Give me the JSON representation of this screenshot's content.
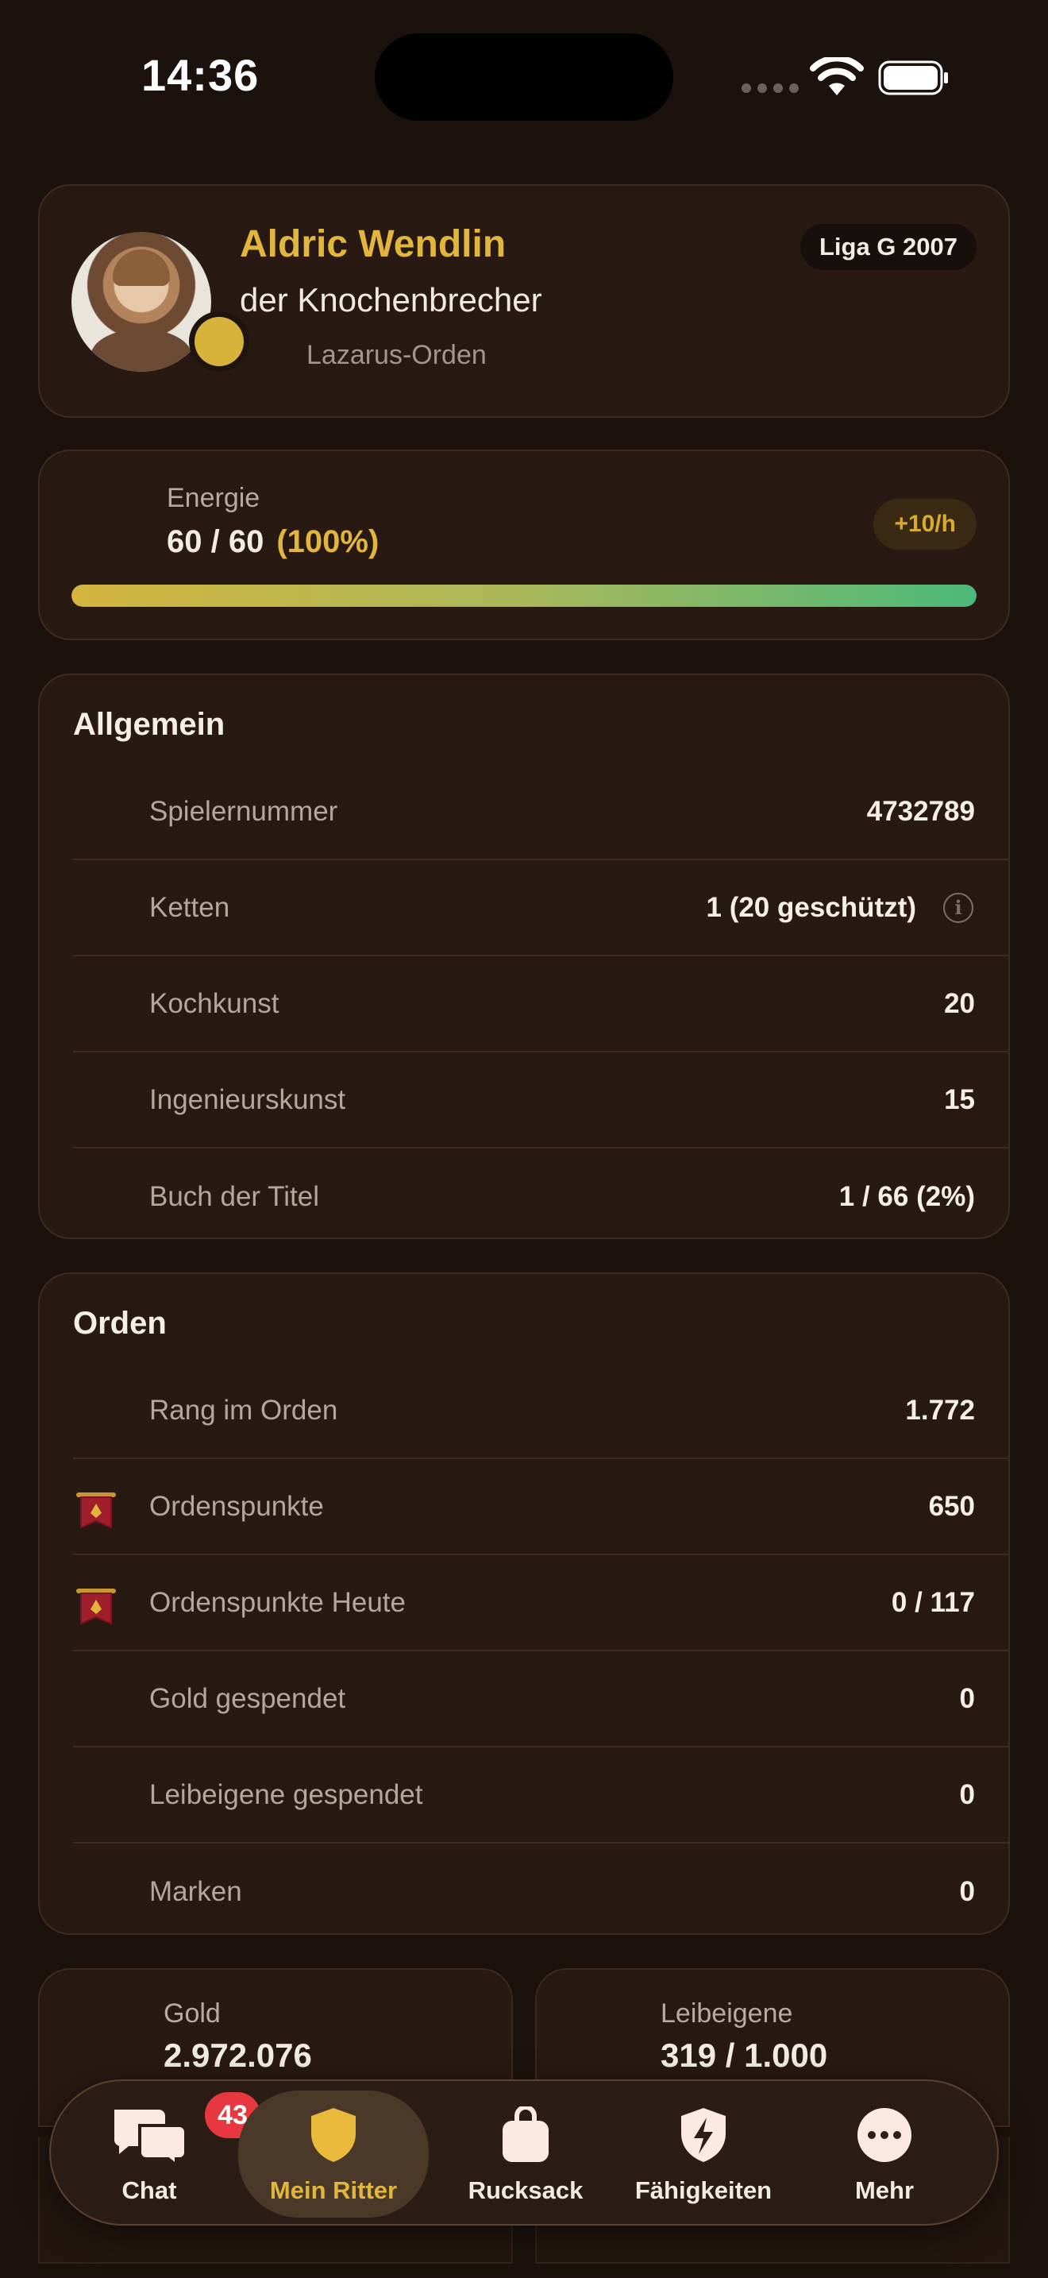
{
  "status_bar": {
    "time": "14:36"
  },
  "profile": {
    "name": "Aldric Wendlin",
    "title": "der Knochenbrecher",
    "order": "Lazarus-Orden",
    "league": "Liga G 2007"
  },
  "energy": {
    "label": "Energie",
    "value": "60 / 60",
    "percent_text": "(100%)",
    "rate": "+10/h",
    "level_fraction": 1.0
  },
  "allgemein": {
    "title": "Allgemein",
    "rows": [
      {
        "label": "Spielernummer",
        "value": "4732789"
      },
      {
        "label": "Ketten",
        "value": "1 (20 geschützt)"
      },
      {
        "label": "Kochkunst",
        "value": "20"
      },
      {
        "label": "Ingenieurskunst",
        "value": "15"
      },
      {
        "label": "Buch der Titel",
        "value": "1 / 66 (2%)"
      }
    ]
  },
  "orden": {
    "title": "Orden",
    "rows": [
      {
        "label": "Rang im Orden",
        "value": "1.772"
      },
      {
        "label": "Ordenspunkte",
        "value": "650"
      },
      {
        "label": "Ordenspunkte Heute",
        "value": "0 / 117"
      },
      {
        "label": "Gold gespendet",
        "value": "0"
      },
      {
        "label": "Leibeigene gespendet",
        "value": "0"
      },
      {
        "label": "Marken",
        "value": "0"
      }
    ]
  },
  "stats": {
    "gold": {
      "label": "Gold",
      "value": "2.972.076"
    },
    "serfs": {
      "label": "Leibeigene",
      "value": "319 / 1.000"
    }
  },
  "tabbar": {
    "tabs": [
      {
        "label": "Chat",
        "icon": "chat-bubbles-icon",
        "badge": "43"
      },
      {
        "label": "Mein Ritter",
        "icon": "shield-icon",
        "active": true
      },
      {
        "label": "Rucksack",
        "icon": "backpack-icon"
      },
      {
        "label": "Fähigkeiten",
        "icon": "lightning-shield-icon"
      },
      {
        "label": "Mehr",
        "icon": "more-dots-icon"
      }
    ]
  },
  "colors": {
    "background": "#1c120d",
    "card": "#281912",
    "accent_gold": "#e2b63c",
    "badge_red": "#e8383f"
  }
}
